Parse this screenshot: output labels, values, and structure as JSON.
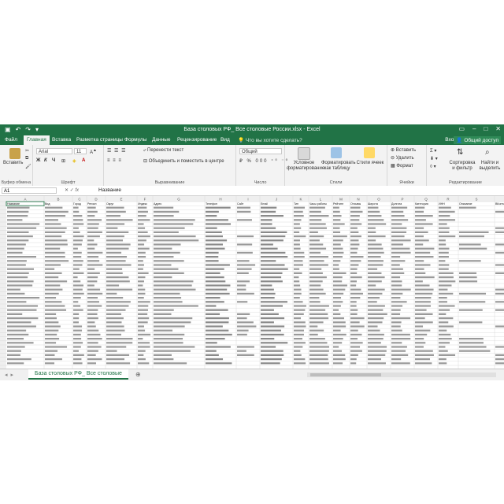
{
  "window": {
    "title": "База столовых РФ_ Все столовые России.xlsx - Excel",
    "signin": "Вход",
    "share": "Общий доступ"
  },
  "ribbon": {
    "tabs": [
      "Файл",
      "Главная",
      "Вставка",
      "Разметка страницы",
      "Формулы",
      "Данные",
      "Рецензирование",
      "Вид"
    ],
    "active_tab": "Главная",
    "tell_me": "Что вы хотите сделать?",
    "clipboard": {
      "paste": "Вставить",
      "caption": "Буфер обмена"
    },
    "font": {
      "name": "Arial",
      "size": "11",
      "bold": "Ж",
      "italic": "К",
      "underline": "Ч",
      "caption": "Шрифт"
    },
    "alignment": {
      "wrap": "Перенести текст",
      "merge": "Объединить и поместить в центре",
      "caption": "Выравнивание"
    },
    "number": {
      "format": "Общий",
      "caption": "Число"
    },
    "styles": {
      "conditional": "Условное форматирование",
      "table": "Форматировать как таблицу",
      "cell": "Стили ячеек",
      "caption": "Стили"
    },
    "cells": {
      "insert": "Вставить",
      "delete": "Удалить",
      "format": "Формат",
      "caption": "Ячейки"
    },
    "editing": {
      "sort": "Сортировка и фильтр",
      "find": "Найти и выделить",
      "caption": "Редактирование"
    }
  },
  "formula_bar": {
    "name_box": "A1",
    "fx": "fx",
    "value": "Название"
  },
  "grid": {
    "columns": [
      "A",
      "B",
      "C",
      "D",
      "E",
      "F",
      "G",
      "H",
      "I",
      "J",
      "K",
      "L",
      "M",
      "N",
      "O",
      "P",
      "Q",
      "R",
      "S",
      "T",
      "U",
      "V"
    ],
    "headers": [
      "Название",
      "Вид",
      "Город",
      "Регион",
      "Округ",
      "Индекс",
      "Адрес",
      "Телефон",
      "Сайт",
      "Email",
      "Тип",
      "Часы работы",
      "Рейтинг",
      "Отзывы",
      "Широта",
      "Долгота",
      "Категория",
      "ИНН",
      "Описание",
      "ВКонтакте",
      "Instagram",
      "Источник"
    ]
  },
  "sheet": {
    "name": "База столовых РФ_ Все столовые"
  },
  "colors": {
    "excel_green": "#217346",
    "ribbon_bg": "#f3f3f3",
    "grid_line": "#d4d4d4",
    "header_bg": "#efefef"
  }
}
